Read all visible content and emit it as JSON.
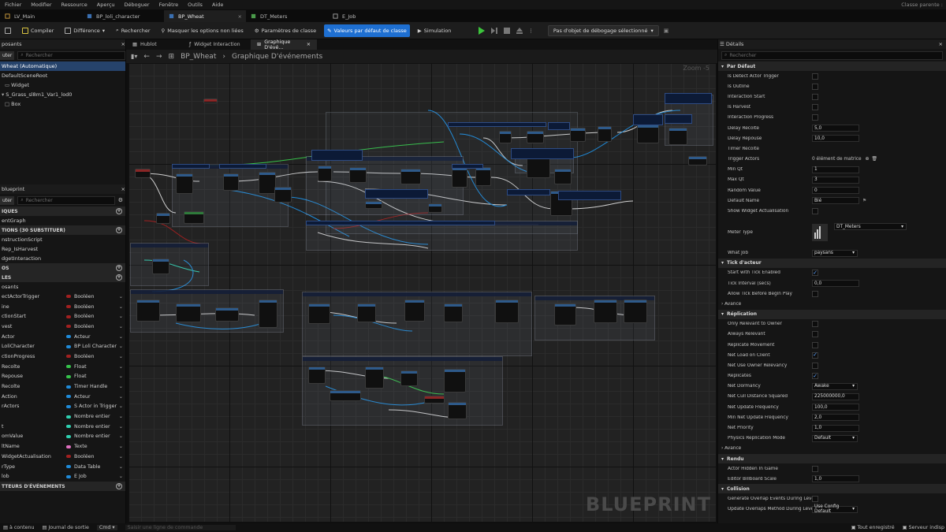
{
  "menu": [
    "Fichier",
    "Modifier",
    "Ressource",
    "Aperçu",
    "Déboguer",
    "Fenêtre",
    "Outils",
    "Aide"
  ],
  "menu_right": "Classe parente :",
  "tabs": [
    {
      "label": "LV_Main",
      "icon": "level-icon",
      "active": false
    },
    {
      "label": "BP_loli_character",
      "icon": "blueprint-icon",
      "active": false
    },
    {
      "label": "BP_Wheat",
      "icon": "blueprint-icon",
      "active": true
    },
    {
      "label": "DT_Meters",
      "icon": "datatable-icon",
      "active": false
    },
    {
      "label": "E_Job",
      "icon": "enum-icon",
      "active": false
    }
  ],
  "toolbar": {
    "compile": "Compiler",
    "diff": "Différence",
    "search": "Rechercher",
    "hide": "Masquer les options non liées",
    "class_params": "Paramètres de classe",
    "class_defaults": "Valeurs par défaut de classe",
    "simulation": "Simulation",
    "debug_object": "Pas d'objet de débogage sélectionné"
  },
  "components": {
    "title": "posants",
    "add": "uter",
    "search_placeholder": "Rechercher",
    "items": [
      {
        "label": "Wheat (Automatique)",
        "selected": true
      },
      {
        "label": "DefaultSceneRoot",
        "selected": false
      },
      {
        "label": "Widget",
        "selected": false
      },
      {
        "label": "S_Grass_sl8m1_Var1_lod0",
        "selected": false
      },
      {
        "label": "Box",
        "selected": false
      }
    ]
  },
  "mybp": {
    "title": "blueprint",
    "add": "uter",
    "search_placeholder": "Rechercher",
    "sec_graphs": "IQUES",
    "graph_item": "entGraph",
    "sec_functions": "TIONS (30 SUBSTITUER)",
    "functions": [
      "nstructionScript",
      "Rep_IsHarvest",
      "dgetInteraction"
    ],
    "sec_macros": "OS",
    "sec_vars": "LES",
    "vars_header": "osants",
    "vars": [
      {
        "name": "ectActorTrigger",
        "type": "Booléen",
        "color": "#a02020"
      },
      {
        "name": "ine",
        "type": "Booléen",
        "color": "#a02020"
      },
      {
        "name": "ctionStart",
        "type": "Booléen",
        "color": "#a02020"
      },
      {
        "name": "vest",
        "type": "Booléen",
        "color": "#a02020"
      },
      {
        "name": "Actor",
        "type": "Acteur",
        "color": "#1f8ad8"
      },
      {
        "name": "LoliCharacter",
        "type": "BP Loli Character",
        "color": "#1f8ad8"
      },
      {
        "name": "ctionProgress",
        "type": "Booléen",
        "color": "#a02020"
      },
      {
        "name": "Recolte",
        "type": "Float",
        "color": "#36c24a"
      },
      {
        "name": "Repouse",
        "type": "Float",
        "color": "#36c24a"
      },
      {
        "name": "Recolte",
        "type": "Timer Handle",
        "color": "#1f8ad8"
      },
      {
        "name": "Action",
        "type": "Acteur",
        "color": "#1f8ad8"
      },
      {
        "name": "rActors",
        "type": "S Actor in Trigger",
        "color": "#1f8ad8"
      },
      {
        "name": "",
        "type": "Nombre entier",
        "color": "#2fd0b0"
      },
      {
        "name": "t",
        "type": "Nombre entier",
        "color": "#2fd0b0"
      },
      {
        "name": "omValue",
        "type": "Nombre entier",
        "color": "#2fd0b0"
      },
      {
        "name": "ltName",
        "type": "Texte",
        "color": "#e070c0"
      },
      {
        "name": "WidgetActualisation",
        "type": "Booléen",
        "color": "#a02020"
      },
      {
        "name": "rType",
        "type": "Data Table",
        "color": "#1f8ad8"
      },
      {
        "name": "lob",
        "type": "E Job",
        "color": "#1f8ad8"
      }
    ],
    "sec_dispatchers": "TTEURS D'ÉVÉNEMENTS"
  },
  "graph_tabs": [
    {
      "label": "Hublot",
      "active": false
    },
    {
      "label": "Widget Interaction",
      "active": false
    },
    {
      "label": "Graphique D'évé...",
      "active": true
    }
  ],
  "breadcrumb": {
    "bp": "BP_Wheat",
    "graph": "Graphique D'événements"
  },
  "zoom": "Zoom -5",
  "watermark": "BLUEPRINT",
  "details": {
    "title": "Détails",
    "search_placeholder": "Rechercher",
    "sections": [
      {
        "name": "Par Défaut",
        "rows": [
          {
            "label": "Is Detect Actor Trigger",
            "kind": "check",
            "value": false
          },
          {
            "label": "Is Outline",
            "kind": "check",
            "value": false
          },
          {
            "label": "Interaction Start",
            "kind": "check",
            "value": false
          },
          {
            "label": "Is Harvest",
            "kind": "check",
            "value": false
          },
          {
            "label": "Interaction Progress",
            "kind": "check",
            "value": false
          },
          {
            "label": "Delay Recolte",
            "kind": "num",
            "value": "5,0"
          },
          {
            "label": "Delay Repouse",
            "kind": "num",
            "value": "10,0"
          },
          {
            "label": "Timer Recolte",
            "kind": "none",
            "value": ""
          },
          {
            "label": "Trigger Actors",
            "kind": "text",
            "value": "0 élément de matrice"
          },
          {
            "label": "Min Qt",
            "kind": "num",
            "value": "1"
          },
          {
            "label": "Max Qt",
            "kind": "num",
            "value": "3"
          },
          {
            "label": "Random Value",
            "kind": "num",
            "value": "0"
          },
          {
            "label": "Default Name",
            "kind": "num",
            "value": "Blé"
          },
          {
            "label": "Show Widget Actualisation",
            "kind": "check",
            "value": false
          },
          {
            "label": "Meter Type",
            "kind": "asset",
            "value": "DT_Meters"
          },
          {
            "label": "What Job",
            "kind": "select",
            "value": "paysans"
          }
        ]
      },
      {
        "name": "Tick d'acteur",
        "rows": [
          {
            "label": "Start with Tick Enabled",
            "kind": "check",
            "value": true
          },
          {
            "label": "Tick Interval (secs)",
            "kind": "num",
            "value": "0,0"
          },
          {
            "label": "Allow Tick Before Begin Play",
            "kind": "check",
            "value": false
          },
          {
            "label": "Avancé",
            "kind": "sub",
            "value": ""
          }
        ]
      },
      {
        "name": "Réplication",
        "rows": [
          {
            "label": "Only Relevant to Owner",
            "kind": "check",
            "value": false
          },
          {
            "label": "Always Relevant",
            "kind": "check",
            "value": false
          },
          {
            "label": "Replicate Movement",
            "kind": "check",
            "value": false
          },
          {
            "label": "Net Load on Client",
            "kind": "check",
            "value": true
          },
          {
            "label": "Net Use Owner Relevancy",
            "kind": "check",
            "value": false
          },
          {
            "label": "Replicates",
            "kind": "check",
            "value": true
          },
          {
            "label": "Net Dormancy",
            "kind": "select",
            "value": "Awake"
          },
          {
            "label": "Net Cull Distance Squared",
            "kind": "num",
            "value": "225000000,0"
          },
          {
            "label": "Net Update Frequency",
            "kind": "num",
            "value": "100,0"
          },
          {
            "label": "Min Net Update Frequency",
            "kind": "num",
            "value": "2,0"
          },
          {
            "label": "Net Priority",
            "kind": "num",
            "value": "1,0"
          },
          {
            "label": "Physics Replication Mode",
            "kind": "select",
            "value": "Default"
          },
          {
            "label": "Avancé",
            "kind": "sub",
            "value": ""
          }
        ]
      },
      {
        "name": "Rendu",
        "rows": [
          {
            "label": "Actor Hidden In Game",
            "kind": "check",
            "value": false
          },
          {
            "label": "Editor Billboard Scale",
            "kind": "num",
            "value": "1,0"
          }
        ]
      },
      {
        "name": "Collision",
        "rows": [
          {
            "label": "Generate Overlap Events During Level Stre...",
            "kind": "check",
            "value": false
          },
          {
            "label": "Update Overlaps Method During Level Stre...",
            "kind": "select",
            "value": "Use Config Default"
          }
        ]
      }
    ]
  },
  "status": {
    "content": "à contenu",
    "log": "Journal de sortie",
    "cmd": "Cmd",
    "console_placeholder": "Saisir une ligne de commande",
    "saved": "Tout enregistré",
    "server": "Serveur indisp"
  }
}
